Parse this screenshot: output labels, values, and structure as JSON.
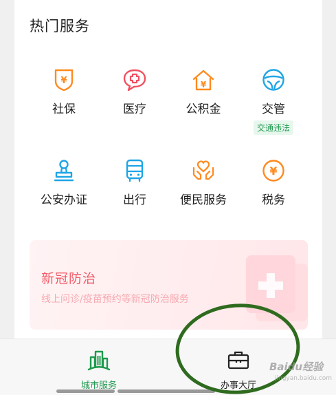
{
  "section": {
    "title": "热门服务"
  },
  "services": [
    {
      "label": "社保",
      "icon": "social-security-shield-icon",
      "color": "#ff8a1f"
    },
    {
      "label": "医疗",
      "icon": "medical-cross-icon",
      "color": "#f0505f"
    },
    {
      "label": "公积金",
      "icon": "housing-fund-house-icon",
      "color": "#ff8a1f"
    },
    {
      "label": "交管",
      "icon": "steering-wheel-icon",
      "color": "#1fa5e6",
      "tag": "交通违法"
    },
    {
      "label": "公安办证",
      "icon": "stamp-icon",
      "color": "#1fa5e6"
    },
    {
      "label": "出行",
      "icon": "bus-icon",
      "color": "#1fa5e6"
    },
    {
      "label": "便民服务",
      "icon": "heart-hands-icon",
      "color": "#ff8a1f"
    },
    {
      "label": "税务",
      "icon": "tax-yuan-coin-icon",
      "color": "#ff8a1f"
    }
  ],
  "banner": {
    "title": "新冠防治",
    "subtitle": "线上问诊/疫苗预约等新冠防治服务",
    "color": "#f05b67"
  },
  "tabs": [
    {
      "label": "城市服务",
      "icon": "city-buildings-icon",
      "active": true,
      "color": "#1f9a4e"
    },
    {
      "label": "办事大厅",
      "icon": "briefcase-icon",
      "active": false,
      "color": "#222222"
    }
  ],
  "annotation": {
    "color": "#2f6b1f"
  },
  "watermark": {
    "text": "Baidu经验",
    "sub": "jingyan.baidu.com"
  }
}
